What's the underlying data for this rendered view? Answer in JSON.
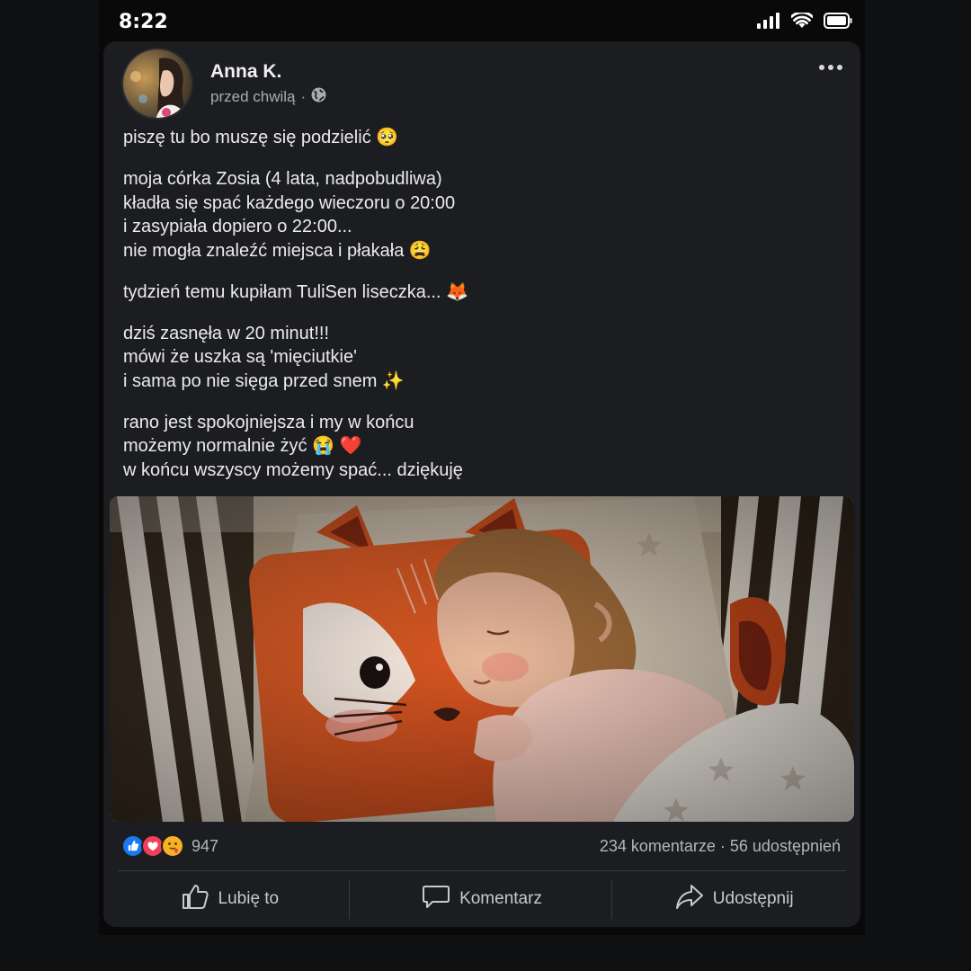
{
  "status_bar": {
    "time": "8:22",
    "icons": [
      "signal-icon",
      "wifi-icon",
      "battery-icon"
    ]
  },
  "post": {
    "author": "Anna K.",
    "time": "przed chwilą",
    "separator": "·",
    "privacy_icon": "globe-icon",
    "paragraphs": [
      [
        "piszę tu bo muszę się podzielić 🥺"
      ],
      [
        "moja córka Zosia (4 lata, nadpobudliwa)",
        "kładła się spać każdego wieczoru o 20:00",
        "i zasypiała dopiero o 22:00...",
        "nie mogła znaleźć miejsca i płakała 😩"
      ],
      [
        "tydzień temu kupiłam TuliSen liseczka... 🦊"
      ],
      [
        "dziś zasnęła w 20 minut!!!",
        "mówi że uszka są 'mięciutkie'",
        "i sama po nie sięga przed snem ✨"
      ],
      [
        "rano jest spokojniejsza i my w końcu",
        "możemy normalnie żyć 😭 ❤️",
        "w końcu wszyscy możemy spać... dziękuję"
      ]
    ],
    "reactions": {
      "icons": [
        "like-icon",
        "love-icon",
        "care-icon"
      ],
      "count": "947"
    },
    "stats": "234 komentarze · 56 udostępnień",
    "actions": [
      {
        "label": "Lubię to",
        "icon": "thumbs-up-icon"
      },
      {
        "label": "Komentarz",
        "icon": "comment-icon"
      },
      {
        "label": "Udostępnij",
        "icon": "share-icon"
      }
    ]
  },
  "colors": {
    "card_bg": "#1c1d20",
    "page_bg": "#0f1012",
    "like_blue": "#1877f2",
    "love_red": "#f33e58",
    "care_yellow": "#f7b125"
  }
}
